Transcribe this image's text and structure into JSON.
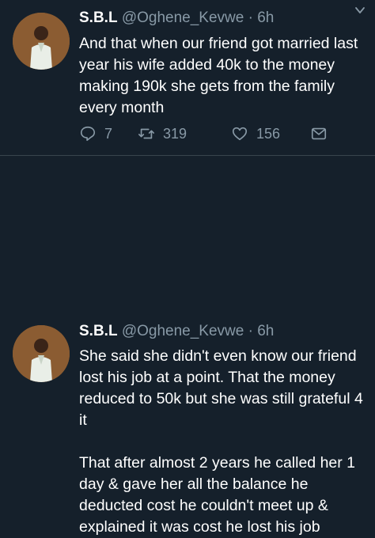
{
  "tweets": [
    {
      "name": "S.B.L",
      "handle": "@Oghene_Kevwe",
      "separator": "·",
      "time": "6h",
      "text": "And that when our friend got married last year his wife added 40k to the money making 190k she gets from the family every month",
      "replies": "7",
      "retweets": "319",
      "likes": "156"
    },
    {
      "name": "S.B.L",
      "handle": "@Oghene_Kevwe",
      "separator": "·",
      "time": "6h",
      "text": "She said she didn't even know our friend lost his job at a point. That the money reduced to 50k but she was still grateful 4 it\n\nThat after almost 2 years he called her 1 day & gave her all the balance he deducted cost he couldn't meet up & explained it was cost he lost his job"
    }
  ],
  "icons": {
    "reply": "speech-bubble-icon",
    "retweet": "retweet-icon",
    "like": "heart-icon",
    "dm": "envelope-icon",
    "menu": "chevron-down-icon"
  },
  "colors": {
    "background": "#15202b",
    "secondary_text": "#8899a6",
    "divider": "#38444d"
  }
}
